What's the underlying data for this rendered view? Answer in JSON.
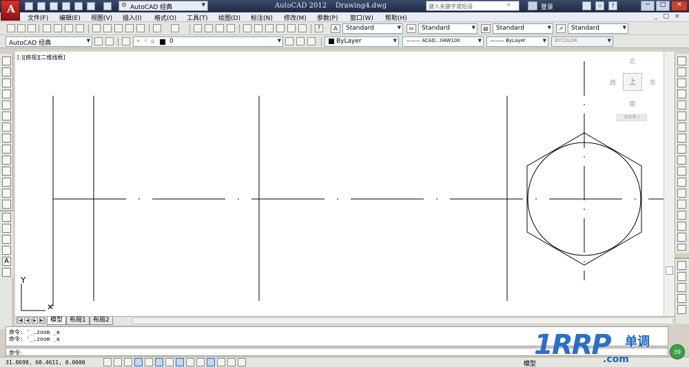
{
  "title_bar": {
    "workspace": "AutoCAD 经典",
    "app_name": "AutoCAD 2012",
    "document": "Drawing4.dwg",
    "search_placeholder": "键入关键字或短语",
    "login": "登录",
    "win_min": "─",
    "win_max": "□",
    "win_close": "✕",
    "gear_glyph": "⚙",
    "arrow_glyph": "▼",
    "search_glyph": "⌕",
    "help_glyph": "?",
    "star_glyph": "☆"
  },
  "menu": [
    "文件(F)",
    "编辑(E)",
    "视图(V)",
    "插入(I)",
    "格式(O)",
    "工具(T)",
    "绘图(D)",
    "标注(N)",
    "修改(M)",
    "参数(P)",
    "窗口(W)",
    "帮助(H)"
  ],
  "menu_doc_controls": "_□×",
  "toolbar1": {
    "text_style": "Standard",
    "dim_style": "Standard",
    "table_style": "Standard",
    "mleader_style": "Standard",
    "help_glyph": "?"
  },
  "toolbar2": {
    "workspace_combo": "AutoCAD 经典",
    "layer": "0",
    "color": "ByLayer",
    "linetype": "——— ACAD...04W100",
    "lineweight": "——— ByLayer",
    "plot_style": "BYCOLOR"
  },
  "viewport_label": "[-][俯视][二维线框]",
  "viewcube": {
    "north": "北",
    "south": "南",
    "east": "东",
    "west": "西",
    "top": "上",
    "ucs": "未命名 ▿"
  },
  "ucs_axes": {
    "y": "Y",
    "x_marker": "✕"
  },
  "tabs": {
    "nav": [
      "|◀",
      "◀",
      "▶",
      "▶|"
    ],
    "items": [
      "模型",
      "布局1",
      "布局2"
    ],
    "active": 0
  },
  "command": {
    "history": [
      "命令: '_.zoom _e",
      "命令: '_.zoom _e"
    ],
    "prompt": "命令:"
  },
  "status": {
    "coords": "31.8698,  60.4611, 0.0000",
    "model": "模型"
  },
  "watermark": {
    "text": "1RRP",
    "chinese": "单调",
    "suffix": ".com",
    "badge": "39"
  }
}
